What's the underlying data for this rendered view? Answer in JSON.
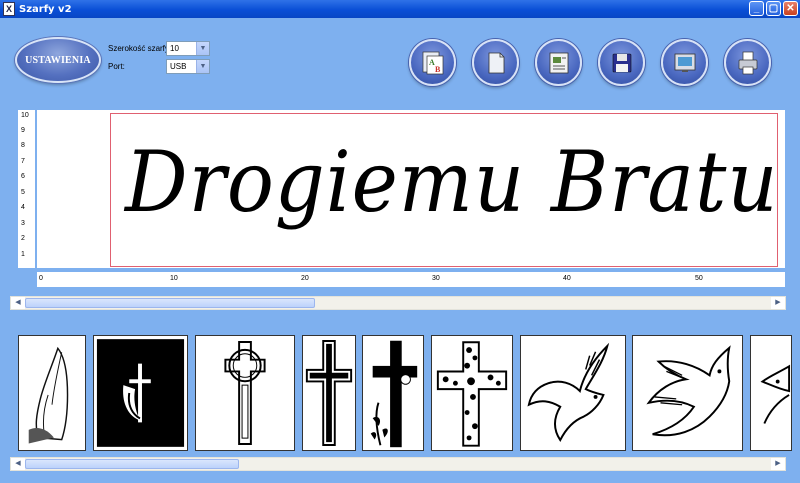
{
  "window": {
    "title": "Szarfy v2",
    "minimize_glyph": "_",
    "maximize_glyph": "▢",
    "close_glyph": "✕"
  },
  "settings": {
    "button_label": "USTAWIENIA",
    "width_label": "Szerokość szarfy:",
    "width_value": "10",
    "port_label": "Port:",
    "port_value": "USB"
  },
  "toolbar": {
    "icons": [
      "font-icon",
      "new-document-icon",
      "open-document-icon",
      "save-floppy-icon",
      "preview-icon",
      "print-icon"
    ]
  },
  "canvas": {
    "text": "Drogiemu Bratu",
    "vertical_ruler": [
      "10",
      "9",
      "8",
      "7",
      "6",
      "5",
      "4",
      "3",
      "2",
      "1"
    ],
    "horizontal_ruler": [
      "0",
      "10",
      "20",
      "30",
      "40",
      "50"
    ]
  },
  "gallery": {
    "items": [
      "praying-hands",
      "chalice-cross",
      "celtic-cross",
      "outlined-cross",
      "cross-with-flower",
      "floral-cross",
      "dove",
      "dove-with-branch",
      "dove-partial"
    ]
  },
  "colors": {
    "background": "#7eb0ef",
    "title_bar": "#0a4fd6",
    "print_border": "#e06070"
  }
}
